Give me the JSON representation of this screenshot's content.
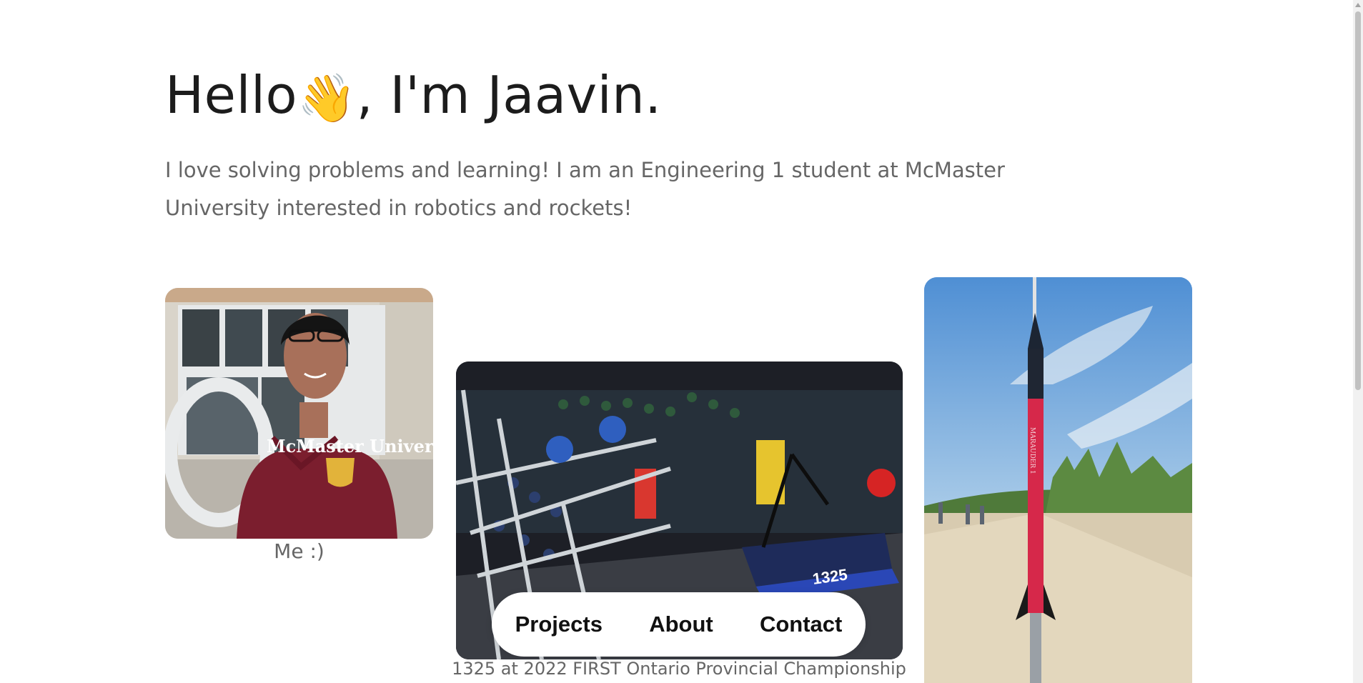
{
  "hero": {
    "greeting": "Hello",
    "wave_emoji": "👋",
    "rest": ", I'm Jaavin.",
    "intro": "I love solving problems and learning! I am an Engineering 1 student at McMaster University interested in robotics and rockets!"
  },
  "photos": [
    {
      "name": "portrait-photo",
      "caption": "Me :)",
      "hoodie_text": "McMaster University"
    },
    {
      "name": "robot-photo",
      "caption": "1325 at 2022 FIRST Ontario Provincial Championship",
      "robot_number": "1325"
    },
    {
      "name": "rocket-photo",
      "caption": "",
      "rocket_text": "MARAUDER 1"
    }
  ],
  "nav": {
    "items": [
      {
        "label": "Projects"
      },
      {
        "label": "About"
      },
      {
        "label": "Contact"
      }
    ]
  },
  "colors": {
    "text": "#1c1c1c",
    "muted": "#666666",
    "background": "#ffffff",
    "hoodie": "#7b1e2e",
    "rocket": "#d62a4b"
  }
}
